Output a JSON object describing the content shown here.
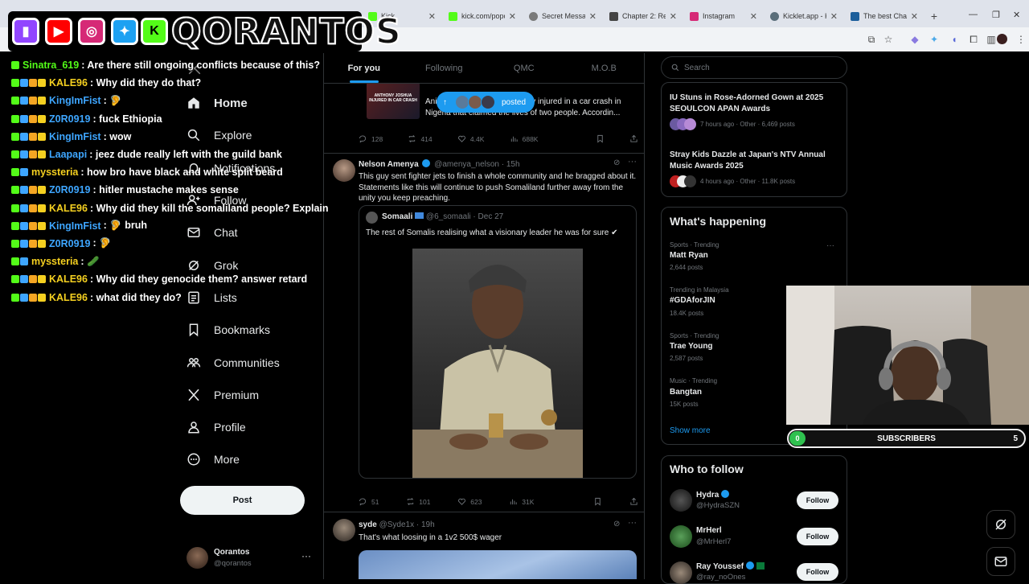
{
  "browser": {
    "tabs": [
      {
        "label": "Kick",
        "color": "#53fc18"
      },
      {
        "label": "kick.com/popo",
        "color": "#53fc18"
      },
      {
        "label": "Secret Messag",
        "color": "#7a7a7a"
      },
      {
        "label": "Chapter 2: Res",
        "color": "#444444"
      },
      {
        "label": "Instagram",
        "color": "#d62976"
      },
      {
        "label": "Kicklet.app - Ki",
        "color": "#5a6e7a"
      },
      {
        "label": "The best Chat",
        "color": "#1b5e9b"
      }
    ],
    "new_tab": "+"
  },
  "overlay": {
    "brand_name": "QORANTOS",
    "chat": [
      {
        "user": "Sinatra_619",
        "color": "#53fc18",
        "message": ": Are there still ongoing conflicts because of this?"
      },
      {
        "user": "KALE96",
        "color": "#f5d020",
        "message": ": Why did they do that?"
      },
      {
        "user": "KingImFist",
        "color": "#3ea6ff",
        "message": ": 🦻"
      },
      {
        "user": "Z0R0919",
        "color": "#3ea6ff",
        "message": ": fuck Ethiopia"
      },
      {
        "user": "KingImFist",
        "color": "#3ea6ff",
        "message": ": wow"
      },
      {
        "user": "Laapapi",
        "color": "#3ea6ff",
        "message": ": jeez dude really left with the guild bank"
      },
      {
        "user": "myssteria",
        "color": "#f5d020",
        "message": ": how bro have black and white split beard"
      },
      {
        "user": "Z0R0919",
        "color": "#3ea6ff",
        "message": ": hitler mustache makes sense"
      },
      {
        "user": "KALE96",
        "color": "#f5d020",
        "message": ": Why did they kill the somaliland people? Explain"
      },
      {
        "user": "KingImFist",
        "color": "#3ea6ff",
        "message": ": 🦻 bruh"
      },
      {
        "user": "Z0R0919",
        "color": "#3ea6ff",
        "message": ": 🦻"
      },
      {
        "user": "myssteria",
        "color": "#f5d020",
        "message": ": 🥒"
      },
      {
        "user": "KALE96",
        "color": "#f5d020",
        "message": ": Why did they genocide them? answer retard"
      },
      {
        "user": "KALE96",
        "color": "#f5d020",
        "message": ": what did they do?"
      }
    ]
  },
  "nav": {
    "items": [
      {
        "label": "Home",
        "icon": "home-icon"
      },
      {
        "label": "Explore",
        "icon": "search-icon"
      },
      {
        "label": "Notifications",
        "icon": "bell-icon"
      },
      {
        "label": "Follow",
        "icon": "person-add-icon"
      },
      {
        "label": "Chat",
        "icon": "mail-icon"
      },
      {
        "label": "Grok",
        "icon": "grok-icon"
      },
      {
        "label": "Lists",
        "icon": "list-icon"
      },
      {
        "label": "Bookmarks",
        "icon": "bookmark-icon"
      },
      {
        "label": "Communities",
        "icon": "communities-icon"
      },
      {
        "label": "Premium",
        "icon": "x-logo-icon"
      },
      {
        "label": "Profile",
        "icon": "person-icon"
      },
      {
        "label": "More",
        "icon": "more-circle-icon"
      }
    ],
    "post_label": "Post",
    "account": {
      "name": "Qorantos",
      "handle": "@qorantos",
      "more": "···"
    }
  },
  "feed": {
    "tabs": [
      "For you",
      "Following",
      "QMC",
      "M.O.B"
    ],
    "posted_pill": "posted",
    "tweet0": {
      "text_line1": "Ani",
      "text_line1b": "dly injured in a car crash in",
      "text_line2": "Nigeria that claimed the lives of two people. Accordin...",
      "image_caption": "ANTHONY JOSHUA INJURED IN CAR CRASH",
      "replies": "128",
      "reposts": "414",
      "likes": "4.4K",
      "views": "688K"
    },
    "tweet1": {
      "name": "Nelson Amenya",
      "handle": "@amenya_nelson · 15h",
      "text": "This guy sent fighter jets to finish a whole community and he bragged about it. Statements like this will continue to push Somaliland further away from the unity you keep preaching.",
      "quote_name": "Somaali",
      "quote_handle": "@6_somaali · Dec 27",
      "quote_text": "The rest of Somalis realising what a visionary leader he was for sure ✔",
      "replies": "51",
      "reposts": "101",
      "likes": "623",
      "views": "31K"
    },
    "tweet2": {
      "name": "syde",
      "handle": "@Syde1x · 19h",
      "text": "That's what loosing in a 1v2 500$ wager"
    }
  },
  "right": {
    "search_placeholder": "Search",
    "news": [
      {
        "title": "IU Stuns in Rose-Adorned Gown at 2025 SEOULCON APAN Awards",
        "sub": "7 hours ago · Other · 6,469 posts"
      },
      {
        "title": "Stray Kids Dazzle at Japan's NTV Annual Music Awards 2025",
        "sub": "4 hours ago · Other · 11.8K posts"
      }
    ],
    "happening_title": "What's happening",
    "trends": [
      {
        "meta": "Sports · Trending",
        "name": "Matt Ryan",
        "posts": "2,644 posts"
      },
      {
        "meta": "Trending in Malaysia",
        "name": "#GDAforJIN",
        "posts": "18.4K posts"
      },
      {
        "meta": "Sports · Trending",
        "name": "Trae Young",
        "posts": "2,587 posts"
      },
      {
        "meta": "Music · Trending",
        "name": "Bangtan",
        "posts": "15K posts"
      }
    ],
    "show_more": "Show more",
    "wtf_title": "Who to follow",
    "wtf": [
      {
        "name": "Hydra",
        "handle": "@HydraSZN",
        "btn": "Follow"
      },
      {
        "name": "MrHerl",
        "handle": "@MrHerl7",
        "btn": "Follow"
      },
      {
        "name": "Ray Youssef",
        "handle": "@ray_noOnes",
        "btn": "Follow"
      }
    ]
  },
  "stream": {
    "sub_current": "0",
    "sub_label": "SUBSCRIBERS",
    "sub_goal": "5"
  }
}
